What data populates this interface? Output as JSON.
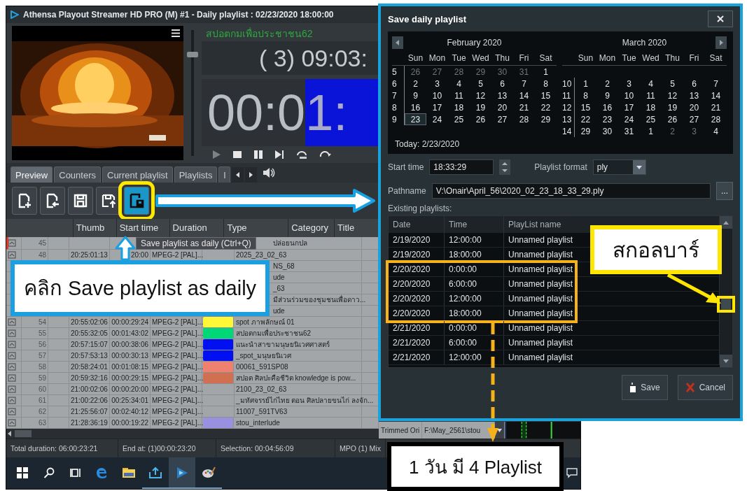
{
  "app_window": {
    "title": "Athensa Playout Streamer HD PRO (M) #1 - Daily playlist : 02/23/2020 18:00:00",
    "now_playing": "สปอตกมเพื่อประชาชน62",
    "counter": "( 3) 09:03:",
    "timer": "00:0",
    "timer_highlight": "1:",
    "volume": {
      "level": 0.82
    },
    "tabs": [
      {
        "label": "Preview",
        "selected": true
      },
      {
        "label": "Counters",
        "selected": false
      },
      {
        "label": "Current playlist",
        "selected": false
      },
      {
        "label": "Playlists",
        "selected": false
      },
      {
        "label": "l",
        "selected": false
      }
    ],
    "toolbar": [
      {
        "kind": "new",
        "selected": false
      },
      {
        "kind": "import",
        "selected": false
      },
      {
        "kind": "save",
        "selected": false
      },
      {
        "kind": "save-as",
        "selected": false
      },
      {
        "kind": "save-daily",
        "selected": true
      }
    ],
    "tooltip": "Save playlist as daily (Ctrl+Q)",
    "table": {
      "columns": [
        "Thumb",
        "Start time",
        "Duration",
        "Type",
        "Category",
        "Title"
      ],
      "rows": [
        {
          "number": "45",
          "title": "ปล่อยนกปล",
          "current": true
        },
        {
          "number": "48",
          "start": "20:25:01:13",
          "duration": "20:00",
          "type": "MPEG-2 [PAL]...",
          "title": "2025_23_02_63",
          "current": false
        },
        {
          "title": "NS_68",
          "current": false
        },
        {
          "title": "ude",
          "current": false
        },
        {
          "title": "_63",
          "current": false
        },
        {
          "title": "มีส่วนร่วมของชุมชนเพื่อดาว...",
          "current": false
        },
        {
          "title": "ude",
          "current": false
        },
        {
          "number": "54",
          "start": "20:55:02:06",
          "duration": "00:00:29:24",
          "type": "MPEG-2 [PAL]...",
          "color": "#fff838",
          "title": "spot ภาพลักษณ์ 01",
          "current": false
        },
        {
          "number": "55",
          "start": "20:55:32:05",
          "duration": "00:01:43:02",
          "type": "MPEG-2 [PAL]...",
          "color": "#00d878",
          "title": "สปอตกมเพื่อประชาชน62",
          "current": false
        },
        {
          "number": "56",
          "start": "20:57:15:07",
          "duration": "00:00:38:06",
          "type": "MPEG-2 [PAL]...",
          "color": "#0010f0",
          "title": "แนะนำสาขามนุษยนิเวศศาสตร์",
          "current": false
        },
        {
          "number": "57",
          "start": "20:57:53:13",
          "duration": "00:00:30:13",
          "type": "MPEG-2 [PAL]...",
          "color": "#0010f0",
          "title": "_spot_มนุษยนิเวศ",
          "current": false
        },
        {
          "number": "58",
          "start": "20:58:24:01",
          "duration": "00:01:08:15",
          "type": "MPEG-2 [PAL]...",
          "color": "#f08070",
          "title": "00061_591SP08",
          "current": false
        },
        {
          "number": "59",
          "start": "20:59:32:16",
          "duration": "00:00:29:15",
          "type": "MPEG-2 [PAL]...",
          "color": "#d07050",
          "title": "สปอต ศิลปะคือชีวิต knowledge is pow...",
          "current": false
        },
        {
          "number": "60",
          "start": "21:00:02:06",
          "duration": "00:00:20:00",
          "type": "MPEG-2 [PAL]...",
          "title": "2100_23_02_63",
          "current": false
        },
        {
          "number": "61",
          "start": "21:00:22:06",
          "duration": "00:25:34:01",
          "type": "MPEG-2 [PAL]...",
          "title": "_มหัศจรรย์ไก่ไทย ตอน ศิลปลายขนไก่ ลงจัก...",
          "current": false
        },
        {
          "number": "62",
          "start": "21:25:56:07",
          "duration": "00:02:40:12",
          "type": "MPEG-2 [PAL]...",
          "title": "11007_591TV63",
          "current": false
        },
        {
          "number": "63",
          "start": "21:28:36:19",
          "duration": "00:00:19:22",
          "type": "MPEG-2 [PAL]...",
          "color": "#9a90e0",
          "title": "stou_interlude",
          "current": false
        }
      ]
    },
    "side_table": {
      "type": "Trimmed Ori",
      "path": "F:\\May_2561\\stou"
    },
    "status_bar": [
      "Total duration: 06:00:23:21",
      "End at: (1)00:00:23:20",
      "Selection: 00:04:56:09",
      "MPO (1) Mix"
    ]
  },
  "taskbar": [
    {
      "kind": "start",
      "running": false,
      "selected": false
    },
    {
      "kind": "search",
      "running": false,
      "selected": false
    },
    {
      "kind": "task-view",
      "running": false,
      "selected": false
    },
    {
      "kind": "browser",
      "running": false,
      "selected": false
    },
    {
      "kind": "folder",
      "running": false,
      "selected": false
    },
    {
      "kind": "upload",
      "running": true,
      "selected": false
    },
    {
      "kind": "player",
      "running": true,
      "selected": true
    },
    {
      "kind": "palette",
      "running": true,
      "selected": false
    },
    {
      "kind": "notification",
      "running": false,
      "selected": false
    }
  ],
  "dialog": {
    "title": "Save daily playlist",
    "calendar": {
      "months": [
        {
          "title": "February 2020",
          "weekdays": [
            "Sun",
            "Mon",
            "Tue",
            "Wed",
            "Thu",
            "Fri",
            "Sat"
          ],
          "weeks": [
            {
              "number": "5",
              "days": [
                {
                  "label": "26",
                  "muted": true,
                  "selected": false
                },
                {
                  "label": "27",
                  "muted": true,
                  "selected": false
                },
                {
                  "label": "28",
                  "muted": true,
                  "selected": false
                },
                {
                  "label": "29",
                  "muted": true,
                  "selected": false
                },
                {
                  "label": "30",
                  "muted": true,
                  "selected": false
                },
                {
                  "label": "31",
                  "muted": true,
                  "selected": false
                },
                {
                  "label": "1",
                  "muted": false,
                  "selected": false
                }
              ]
            },
            {
              "number": "6",
              "days": [
                {
                  "label": "2",
                  "muted": false,
                  "selected": false
                },
                {
                  "label": "3",
                  "muted": false,
                  "selected": false
                },
                {
                  "label": "4",
                  "muted": false,
                  "selected": false
                },
                {
                  "label": "5",
                  "muted": false,
                  "selected": false
                },
                {
                  "label": "6",
                  "muted": false,
                  "selected": false
                },
                {
                  "label": "7",
                  "muted": false,
                  "selected": false
                },
                {
                  "label": "8",
                  "muted": false,
                  "selected": false
                }
              ]
            },
            {
              "number": "7",
              "days": [
                {
                  "label": "9",
                  "muted": false,
                  "selected": false
                },
                {
                  "label": "10",
                  "muted": false,
                  "selected": false
                },
                {
                  "label": "11",
                  "muted": false,
                  "selected": false
                },
                {
                  "label": "12",
                  "muted": false,
                  "selected": false
                },
                {
                  "label": "13",
                  "muted": false,
                  "selected": false
                },
                {
                  "label": "14",
                  "muted": false,
                  "selected": false
                },
                {
                  "label": "15",
                  "muted": false,
                  "selected": false
                }
              ]
            },
            {
              "number": "8",
              "days": [
                {
                  "label": "16",
                  "muted": false,
                  "selected": false
                },
                {
                  "label": "17",
                  "muted": false,
                  "selected": false
                },
                {
                  "label": "18",
                  "muted": false,
                  "selected": false
                },
                {
                  "label": "19",
                  "muted": false,
                  "selected": false
                },
                {
                  "label": "20",
                  "muted": false,
                  "selected": false
                },
                {
                  "label": "21",
                  "muted": false,
                  "selected": false
                },
                {
                  "label": "22",
                  "muted": false,
                  "selected": false
                }
              ]
            },
            {
              "number": "9",
              "days": [
                {
                  "label": "23",
                  "muted": false,
                  "selected": true
                },
                {
                  "label": "24",
                  "muted": false,
                  "selected": false
                },
                {
                  "label": "25",
                  "muted": false,
                  "selected": false
                },
                {
                  "label": "26",
                  "muted": false,
                  "selected": false
                },
                {
                  "label": "27",
                  "muted": false,
                  "selected": false
                },
                {
                  "label": "28",
                  "muted": false,
                  "selected": false
                },
                {
                  "label": "29",
                  "muted": false,
                  "selected": false
                }
              ]
            }
          ]
        },
        {
          "title": "March 2020",
          "weekdays": [
            "Sun",
            "Mon",
            "Tue",
            "Wed",
            "Thu",
            "Fri",
            "Sat"
          ],
          "weeks": [
            {
              "number": "10",
              "days": [
                {
                  "label": "1",
                  "muted": false,
                  "selected": false
                },
                {
                  "label": "2",
                  "muted": false,
                  "selected": false
                },
                {
                  "label": "3",
                  "muted": false,
                  "selected": false
                },
                {
                  "label": "4",
                  "muted": false,
                  "selected": false
                },
                {
                  "label": "5",
                  "muted": false,
                  "selected": false
                },
                {
                  "label": "6",
                  "muted": false,
                  "selected": false
                },
                {
                  "label": "7",
                  "muted": false,
                  "selected": false
                }
              ]
            },
            {
              "number": "11",
              "days": [
                {
                  "label": "8",
                  "muted": false,
                  "selected": false
                },
                {
                  "label": "9",
                  "muted": false,
                  "selected": false
                },
                {
                  "label": "10",
                  "muted": false,
                  "selected": false
                },
                {
                  "label": "11",
                  "muted": false,
                  "selected": false
                },
                {
                  "label": "12",
                  "muted": false,
                  "selected": false
                },
                {
                  "label": "13",
                  "muted": false,
                  "selected": false
                },
                {
                  "label": "14",
                  "muted": false,
                  "selected": false
                }
              ]
            },
            {
              "number": "12",
              "days": [
                {
                  "label": "15",
                  "muted": false,
                  "selected": false
                },
                {
                  "label": "16",
                  "muted": false,
                  "selected": false
                },
                {
                  "label": "17",
                  "muted": false,
                  "selected": false
                },
                {
                  "label": "18",
                  "muted": false,
                  "selected": false
                },
                {
                  "label": "19",
                  "muted": false,
                  "selected": false
                },
                {
                  "label": "20",
                  "muted": false,
                  "selected": false
                },
                {
                  "label": "21",
                  "muted": false,
                  "selected": false
                }
              ]
            },
            {
              "number": "13",
              "days": [
                {
                  "label": "22",
                  "muted": false,
                  "selected": false
                },
                {
                  "label": "23",
                  "muted": false,
                  "selected": false
                },
                {
                  "label": "24",
                  "muted": false,
                  "selected": false
                },
                {
                  "label": "25",
                  "muted": false,
                  "selected": false
                },
                {
                  "label": "26",
                  "muted": false,
                  "selected": false
                },
                {
                  "label": "27",
                  "muted": false,
                  "selected": false
                },
                {
                  "label": "28",
                  "muted": false,
                  "selected": false
                }
              ]
            },
            {
              "number": "14",
              "days": [
                {
                  "label": "29",
                  "muted": false,
                  "selected": false
                },
                {
                  "label": "30",
                  "muted": false,
                  "selected": false
                },
                {
                  "label": "31",
                  "muted": false,
                  "selected": false
                },
                {
                  "label": "1",
                  "muted": false,
                  "selected": false
                },
                {
                  "label": "2",
                  "muted": true,
                  "selected": false
                },
                {
                  "label": "3",
                  "muted": true,
                  "selected": false
                },
                {
                  "label": "4",
                  "muted": false,
                  "selected": false
                }
              ]
            }
          ]
        }
      ],
      "today": "Today: 2/23/2020"
    },
    "start_time": {
      "label": "Start time",
      "value": "18:33:29"
    },
    "playlist_format": {
      "label": "Playlist format",
      "value": "ply"
    },
    "pathname": {
      "label": "Pathname",
      "value": "V:\\Onair\\April_56\\2020_02_23_18_33_29.ply",
      "browse": "..."
    },
    "existing_label": "Existing playlists:",
    "playlists": {
      "columns": [
        "Date",
        "Time",
        "PlayList name"
      ],
      "rows": [
        {
          "date": "2/19/2020",
          "time": "12:00:00",
          "name": "Unnamed playlist",
          "highlighted": false
        },
        {
          "date": "2/19/2020",
          "time": "18:00:00",
          "name": "Unnamed playlist",
          "highlighted": false
        },
        {
          "date": "2/20/2020",
          "time": "0:00:00",
          "name": "Unnamed playlist",
          "highlighted": true
        },
        {
          "date": "2/20/2020",
          "time": "6:00:00",
          "name": "Unnamed playlist",
          "highlighted": true
        },
        {
          "date": "2/20/2020",
          "time": "12:00:00",
          "name": "Unnamed playlist",
          "highlighted": true
        },
        {
          "date": "2/20/2020",
          "time": "18:00:00",
          "name": "Unnamed playlist",
          "highlighted": true
        },
        {
          "date": "2/21/2020",
          "time": "0:00:00",
          "name": "Unnamed playlist",
          "highlighted": false
        },
        {
          "date": "2/21/2020",
          "time": "6:00:00",
          "name": "Unnamed playlist",
          "highlighted": false
        },
        {
          "date": "2/21/2020",
          "time": "12:00:00",
          "name": "Unnamed playlist",
          "highlighted": false
        }
      ]
    },
    "buttons": [
      {
        "kind": "save",
        "label": "Save"
      },
      {
        "kind": "cancel",
        "label": "Cancel"
      }
    ]
  },
  "annotations": {
    "click_callout": "คลิก Save playlist as daily",
    "scrollbar_callout": "สกอลบาร์",
    "count_callout": "1 วัน มี 4 Playlist"
  }
}
